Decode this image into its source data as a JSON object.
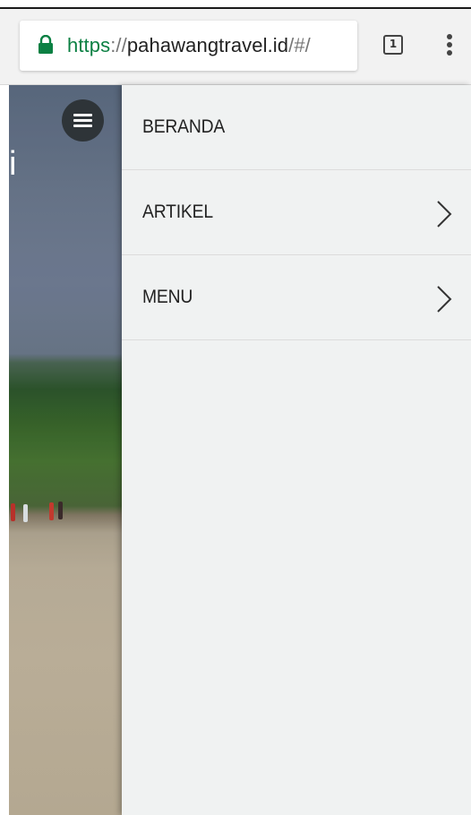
{
  "browser": {
    "url": {
      "scheme": "https",
      "separator": "://",
      "host": "pahawangtravel.id",
      "path": "/#/"
    },
    "tab_count": "1",
    "icons": {
      "secure": "lock-icon",
      "tabs": "tab-switcher-icon",
      "menu": "overflow-menu-icon"
    },
    "colors": {
      "secure_scheme": "#0b8043",
      "chrome_bg": "#f2f2f2"
    }
  },
  "page": {
    "hero_visible_text": "i",
    "menu_toggle_icon": "hamburger-icon",
    "toggle_color": "#2e3438"
  },
  "drawer": {
    "background": "#f0f2f2",
    "items": [
      {
        "label": "BERANDA",
        "has_submenu": false
      },
      {
        "label": "ARTIKEL",
        "has_submenu": true,
        "icon": "chevron-right-icon"
      },
      {
        "label": "MENU",
        "has_submenu": true,
        "icon": "chevron-right-icon"
      }
    ]
  }
}
